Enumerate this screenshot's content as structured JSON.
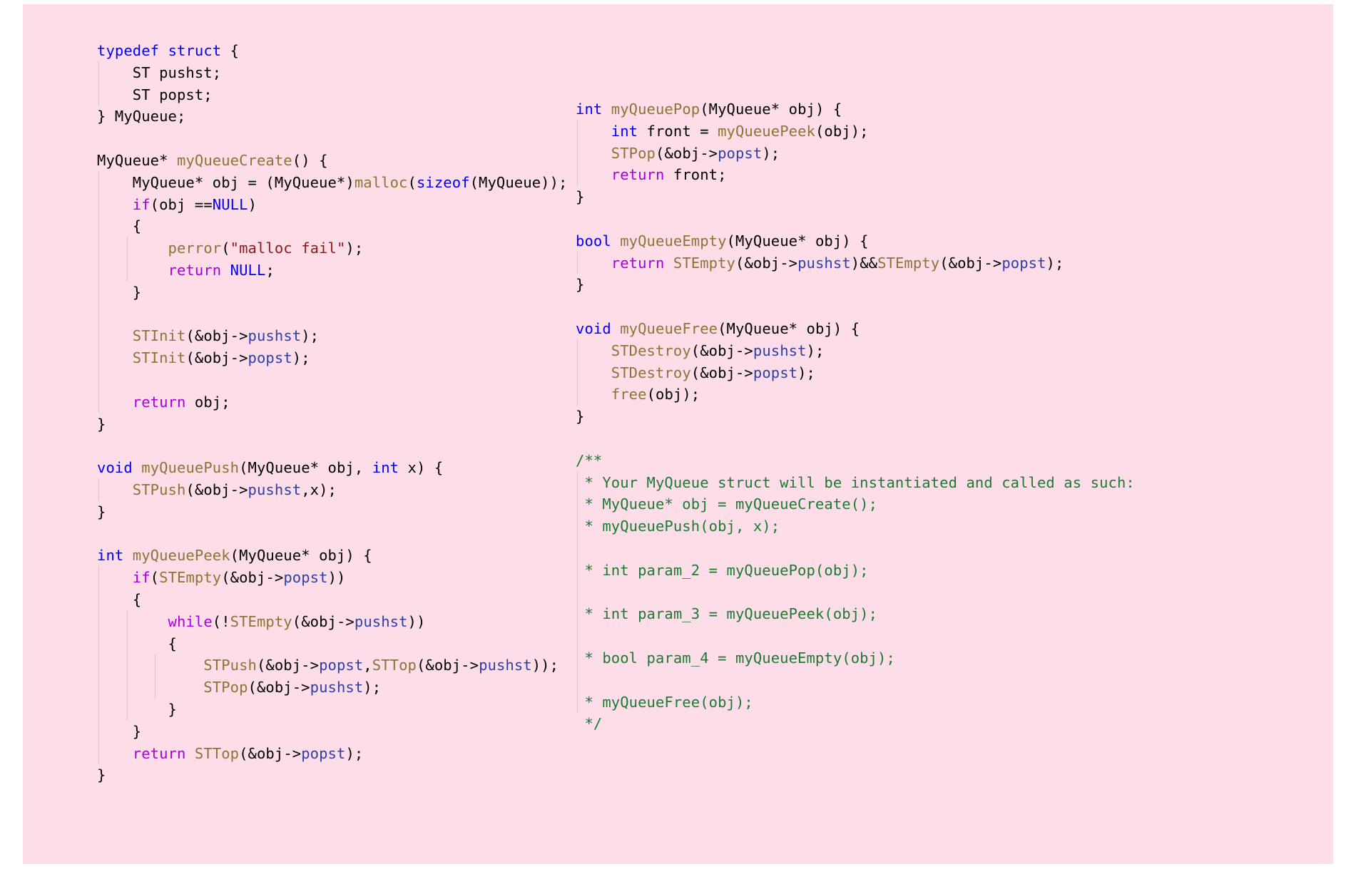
{
  "document": {
    "language": "c",
    "title": "MyQueue implementation in C (two stacks)",
    "background_color": "#fcdde8",
    "page_border_color": "#ffffff"
  },
  "theme": {
    "keyword_color": "#0000ff",
    "control_keyword_color": "#aa00dd",
    "function_color": "#8b7536",
    "member_color": "#2f3fa8",
    "string_color": "#8b1a1a",
    "comment_color": "#1c7a33",
    "plain_color": "#000000",
    "indent_guide_color": "#d9c4cc"
  },
  "left_column": {
    "lines": [
      {
        "indent": 0,
        "guides": [],
        "tokens": [
          {
            "t": "typedef",
            "c": "kw"
          },
          {
            "t": " ",
            "c": "pl"
          },
          {
            "t": "struct",
            "c": "kw"
          },
          {
            "t": " {",
            "c": "pl"
          }
        ]
      },
      {
        "indent": 0,
        "guides": [
          1
        ],
        "tokens": [
          {
            "t": "    ST pushst;",
            "c": "pl"
          }
        ]
      },
      {
        "indent": 0,
        "guides": [
          1
        ],
        "tokens": [
          {
            "t": "    ST popst;",
            "c": "pl"
          }
        ]
      },
      {
        "indent": 0,
        "guides": [],
        "tokens": [
          {
            "t": "} MyQueue;",
            "c": "pl"
          }
        ]
      },
      {
        "indent": 0,
        "guides": [],
        "tokens": []
      },
      {
        "indent": 0,
        "guides": [],
        "tokens": [
          {
            "t": "MyQueue",
            "c": "pl"
          },
          {
            "t": "* ",
            "c": "pl"
          },
          {
            "t": "myQueueCreate",
            "c": "fn"
          },
          {
            "t": "() {",
            "c": "pl"
          }
        ]
      },
      {
        "indent": 0,
        "guides": [
          1
        ],
        "tokens": [
          {
            "t": "    MyQueue* obj = (MyQueue*)",
            "c": "pl"
          },
          {
            "t": "malloc",
            "c": "fn"
          },
          {
            "t": "(",
            "c": "pl"
          },
          {
            "t": "sizeof",
            "c": "kw"
          },
          {
            "t": "(MyQueue));",
            "c": "pl"
          }
        ]
      },
      {
        "indent": 0,
        "guides": [
          1
        ],
        "tokens": [
          {
            "t": "    ",
            "c": "pl"
          },
          {
            "t": "if",
            "c": "ctl"
          },
          {
            "t": "(obj ==",
            "c": "pl"
          },
          {
            "t": "NULL",
            "c": "kw"
          },
          {
            "t": ")",
            "c": "pl"
          }
        ]
      },
      {
        "indent": 0,
        "guides": [
          1
        ],
        "tokens": [
          {
            "t": "    {",
            "c": "pl"
          }
        ]
      },
      {
        "indent": 0,
        "guides": [
          1,
          2
        ],
        "tokens": [
          {
            "t": "        ",
            "c": "pl"
          },
          {
            "t": "perror",
            "c": "fn"
          },
          {
            "t": "(",
            "c": "pl"
          },
          {
            "t": "\"malloc fail\"",
            "c": "str"
          },
          {
            "t": ");",
            "c": "pl"
          }
        ]
      },
      {
        "indent": 0,
        "guides": [
          1,
          2
        ],
        "tokens": [
          {
            "t": "        ",
            "c": "pl"
          },
          {
            "t": "return",
            "c": "ctl"
          },
          {
            "t": " ",
            "c": "pl"
          },
          {
            "t": "NULL",
            "c": "kw"
          },
          {
            "t": ";",
            "c": "pl"
          }
        ]
      },
      {
        "indent": 0,
        "guides": [
          1
        ],
        "tokens": [
          {
            "t": "    }",
            "c": "pl"
          }
        ]
      },
      {
        "indent": 0,
        "guides": [
          1
        ],
        "tokens": []
      },
      {
        "indent": 0,
        "guides": [
          1
        ],
        "tokens": [
          {
            "t": "    ",
            "c": "pl"
          },
          {
            "t": "STInit",
            "c": "fn"
          },
          {
            "t": "(&obj->",
            "c": "pl"
          },
          {
            "t": "pushst",
            "c": "mem"
          },
          {
            "t": ");",
            "c": "pl"
          }
        ]
      },
      {
        "indent": 0,
        "guides": [
          1
        ],
        "tokens": [
          {
            "t": "    ",
            "c": "pl"
          },
          {
            "t": "STInit",
            "c": "fn"
          },
          {
            "t": "(&obj->",
            "c": "pl"
          },
          {
            "t": "popst",
            "c": "mem"
          },
          {
            "t": ");",
            "c": "pl"
          }
        ]
      },
      {
        "indent": 0,
        "guides": [
          1
        ],
        "tokens": []
      },
      {
        "indent": 0,
        "guides": [
          1
        ],
        "tokens": [
          {
            "t": "    ",
            "c": "pl"
          },
          {
            "t": "return",
            "c": "ctl"
          },
          {
            "t": " obj;",
            "c": "pl"
          }
        ]
      },
      {
        "indent": 0,
        "guides": [],
        "tokens": [
          {
            "t": "}",
            "c": "pl"
          }
        ]
      },
      {
        "indent": 0,
        "guides": [],
        "tokens": []
      },
      {
        "indent": 0,
        "guides": [],
        "tokens": [
          {
            "t": "void",
            "c": "kw"
          },
          {
            "t": " ",
            "c": "pl"
          },
          {
            "t": "myQueuePush",
            "c": "fn"
          },
          {
            "t": "(MyQueue* obj, ",
            "c": "pl"
          },
          {
            "t": "int",
            "c": "kw"
          },
          {
            "t": " x) {",
            "c": "pl"
          }
        ]
      },
      {
        "indent": 0,
        "guides": [
          1
        ],
        "tokens": [
          {
            "t": "    ",
            "c": "pl"
          },
          {
            "t": "STPush",
            "c": "fn"
          },
          {
            "t": "(&obj->",
            "c": "pl"
          },
          {
            "t": "pushst",
            "c": "mem"
          },
          {
            "t": ",x);",
            "c": "pl"
          }
        ]
      },
      {
        "indent": 0,
        "guides": [],
        "tokens": [
          {
            "t": "}",
            "c": "pl"
          }
        ]
      },
      {
        "indent": 0,
        "guides": [],
        "tokens": []
      },
      {
        "indent": 0,
        "guides": [],
        "tokens": [
          {
            "t": "int",
            "c": "kw"
          },
          {
            "t": " ",
            "c": "pl"
          },
          {
            "t": "myQueuePeek",
            "c": "fn"
          },
          {
            "t": "(MyQueue* obj) {",
            "c": "pl"
          }
        ]
      },
      {
        "indent": 0,
        "guides": [
          1
        ],
        "tokens": [
          {
            "t": "    ",
            "c": "pl"
          },
          {
            "t": "if",
            "c": "ctl"
          },
          {
            "t": "(",
            "c": "pl"
          },
          {
            "t": "STEmpty",
            "c": "fn"
          },
          {
            "t": "(&obj->",
            "c": "pl"
          },
          {
            "t": "popst",
            "c": "mem"
          },
          {
            "t": "))",
            "c": "pl"
          }
        ]
      },
      {
        "indent": 0,
        "guides": [
          1
        ],
        "tokens": [
          {
            "t": "    {",
            "c": "pl"
          }
        ]
      },
      {
        "indent": 0,
        "guides": [
          1,
          2
        ],
        "tokens": [
          {
            "t": "        ",
            "c": "pl"
          },
          {
            "t": "while",
            "c": "ctl"
          },
          {
            "t": "(!",
            "c": "pl"
          },
          {
            "t": "STEmpty",
            "c": "fn"
          },
          {
            "t": "(&obj->",
            "c": "pl"
          },
          {
            "t": "pushst",
            "c": "mem"
          },
          {
            "t": "))",
            "c": "pl"
          }
        ]
      },
      {
        "indent": 0,
        "guides": [
          1,
          2
        ],
        "tokens": [
          {
            "t": "        {",
            "c": "pl"
          }
        ]
      },
      {
        "indent": 0,
        "guides": [
          1,
          2,
          3
        ],
        "tokens": [
          {
            "t": "            ",
            "c": "pl"
          },
          {
            "t": "STPush",
            "c": "fn"
          },
          {
            "t": "(&obj->",
            "c": "pl"
          },
          {
            "t": "popst",
            "c": "mem"
          },
          {
            "t": ",",
            "c": "pl"
          },
          {
            "t": "STTop",
            "c": "fn"
          },
          {
            "t": "(&obj->",
            "c": "pl"
          },
          {
            "t": "pushst",
            "c": "mem"
          },
          {
            "t": "));",
            "c": "pl"
          }
        ]
      },
      {
        "indent": 0,
        "guides": [
          1,
          2,
          3
        ],
        "tokens": [
          {
            "t": "            ",
            "c": "pl"
          },
          {
            "t": "STPop",
            "c": "fn"
          },
          {
            "t": "(&obj->",
            "c": "pl"
          },
          {
            "t": "pushst",
            "c": "mem"
          },
          {
            "t": ");",
            "c": "pl"
          }
        ]
      },
      {
        "indent": 0,
        "guides": [
          1,
          2
        ],
        "tokens": [
          {
            "t": "        }",
            "c": "pl"
          }
        ]
      },
      {
        "indent": 0,
        "guides": [
          1
        ],
        "tokens": [
          {
            "t": "    }",
            "c": "pl"
          }
        ]
      },
      {
        "indent": 0,
        "guides": [
          1
        ],
        "tokens": [
          {
            "t": "    ",
            "c": "pl"
          },
          {
            "t": "return",
            "c": "ctl"
          },
          {
            "t": " ",
            "c": "pl"
          },
          {
            "t": "STTop",
            "c": "fn"
          },
          {
            "t": "(&obj->",
            "c": "pl"
          },
          {
            "t": "popst",
            "c": "mem"
          },
          {
            "t": ");",
            "c": "pl"
          }
        ]
      },
      {
        "indent": 0,
        "guides": [],
        "tokens": [
          {
            "t": "}",
            "c": "pl"
          }
        ]
      }
    ]
  },
  "right_column": {
    "lines": [
      {
        "guides": [],
        "tokens": [
          {
            "t": "int",
            "c": "kw"
          },
          {
            "t": " ",
            "c": "pl"
          },
          {
            "t": "myQueuePop",
            "c": "fn"
          },
          {
            "t": "(MyQueue* obj) {",
            "c": "pl"
          }
        ]
      },
      {
        "guides": [
          1
        ],
        "tokens": [
          {
            "t": "    ",
            "c": "pl"
          },
          {
            "t": "int",
            "c": "kw"
          },
          {
            "t": " front = ",
            "c": "pl"
          },
          {
            "t": "myQueuePeek",
            "c": "fn"
          },
          {
            "t": "(obj);",
            "c": "pl"
          }
        ]
      },
      {
        "guides": [
          1
        ],
        "tokens": [
          {
            "t": "    ",
            "c": "pl"
          },
          {
            "t": "STPop",
            "c": "fn"
          },
          {
            "t": "(&obj->",
            "c": "pl"
          },
          {
            "t": "popst",
            "c": "mem"
          },
          {
            "t": ");",
            "c": "pl"
          }
        ]
      },
      {
        "guides": [
          1
        ],
        "tokens": [
          {
            "t": "    ",
            "c": "pl"
          },
          {
            "t": "return",
            "c": "ctl"
          },
          {
            "t": " front;",
            "c": "pl"
          }
        ]
      },
      {
        "guides": [],
        "tokens": [
          {
            "t": "}",
            "c": "pl"
          }
        ]
      },
      {
        "guides": [],
        "tokens": []
      },
      {
        "guides": [],
        "tokens": [
          {
            "t": "bool",
            "c": "kw"
          },
          {
            "t": " ",
            "c": "pl"
          },
          {
            "t": "myQueueEmpty",
            "c": "fn"
          },
          {
            "t": "(MyQueue* obj) {",
            "c": "pl"
          }
        ]
      },
      {
        "guides": [
          1
        ],
        "tokens": [
          {
            "t": "    ",
            "c": "pl"
          },
          {
            "t": "return",
            "c": "ctl"
          },
          {
            "t": " ",
            "c": "pl"
          },
          {
            "t": "STEmpty",
            "c": "fn"
          },
          {
            "t": "(&obj->",
            "c": "pl"
          },
          {
            "t": "pushst",
            "c": "mem"
          },
          {
            "t": ")&&",
            "c": "pl"
          },
          {
            "t": "STEmpty",
            "c": "fn"
          },
          {
            "t": "(&obj->",
            "c": "pl"
          },
          {
            "t": "popst",
            "c": "mem"
          },
          {
            "t": ");",
            "c": "pl"
          }
        ]
      },
      {
        "guides": [],
        "tokens": [
          {
            "t": "}",
            "c": "pl"
          }
        ]
      },
      {
        "guides": [],
        "tokens": []
      },
      {
        "guides": [],
        "tokens": [
          {
            "t": "void",
            "c": "kw"
          },
          {
            "t": " ",
            "c": "pl"
          },
          {
            "t": "myQueueFree",
            "c": "fn"
          },
          {
            "t": "(MyQueue* obj) {",
            "c": "pl"
          }
        ]
      },
      {
        "guides": [
          1
        ],
        "tokens": [
          {
            "t": "    ",
            "c": "pl"
          },
          {
            "t": "STDestroy",
            "c": "fn"
          },
          {
            "t": "(&obj->",
            "c": "pl"
          },
          {
            "t": "pushst",
            "c": "mem"
          },
          {
            "t": ");",
            "c": "pl"
          }
        ]
      },
      {
        "guides": [
          1
        ],
        "tokens": [
          {
            "t": "    ",
            "c": "pl"
          },
          {
            "t": "STDestroy",
            "c": "fn"
          },
          {
            "t": "(&obj->",
            "c": "pl"
          },
          {
            "t": "popst",
            "c": "mem"
          },
          {
            "t": ");",
            "c": "pl"
          }
        ]
      },
      {
        "guides": [
          1
        ],
        "tokens": [
          {
            "t": "    ",
            "c": "pl"
          },
          {
            "t": "free",
            "c": "fn"
          },
          {
            "t": "(obj);",
            "c": "pl"
          }
        ]
      },
      {
        "guides": [],
        "tokens": [
          {
            "t": "}",
            "c": "pl"
          }
        ]
      },
      {
        "guides": [],
        "tokens": []
      },
      {
        "guides": [],
        "tokens": [
          {
            "t": "/**",
            "c": "cm"
          }
        ]
      },
      {
        "guides": [
          1
        ],
        "tokens": [
          {
            "t": " * Your MyQueue struct will be instantiated and called as such:",
            "c": "cm"
          }
        ]
      },
      {
        "guides": [
          1
        ],
        "tokens": [
          {
            "t": " * MyQueue* obj = myQueueCreate();",
            "c": "cm"
          }
        ]
      },
      {
        "guides": [
          1
        ],
        "tokens": [
          {
            "t": " * myQueuePush(obj, x);",
            "c": "cm"
          }
        ]
      },
      {
        "guides": [
          1
        ],
        "tokens": []
      },
      {
        "guides": [
          1
        ],
        "tokens": [
          {
            "t": " * int param_2 = myQueuePop(obj);",
            "c": "cm"
          }
        ]
      },
      {
        "guides": [
          1
        ],
        "tokens": []
      },
      {
        "guides": [
          1
        ],
        "tokens": [
          {
            "t": " * int param_3 = myQueuePeek(obj);",
            "c": "cm"
          }
        ]
      },
      {
        "guides": [
          1
        ],
        "tokens": []
      },
      {
        "guides": [
          1
        ],
        "tokens": [
          {
            "t": " * bool param_4 = myQueueEmpty(obj);",
            "c": "cm"
          }
        ]
      },
      {
        "guides": [
          1
        ],
        "tokens": []
      },
      {
        "guides": [
          1
        ],
        "tokens": [
          {
            "t": " * myQueueFree(obj);",
            "c": "cm"
          }
        ]
      },
      {
        "guides": [],
        "tokens": [
          {
            "t": " */",
            "c": "cm"
          }
        ]
      }
    ]
  }
}
